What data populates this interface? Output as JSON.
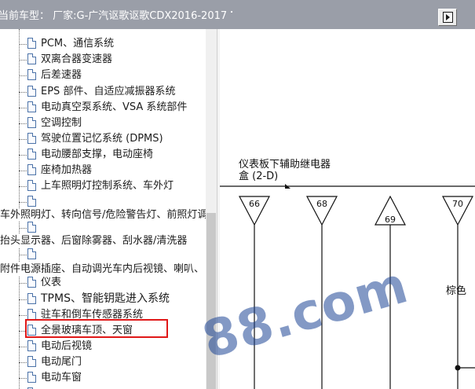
{
  "header": {
    "title": "当前车型： 厂家:G-广汽讴歌讴歌CDX2016-2017"
  },
  "tree": {
    "items": [
      {
        "label": "PCM、通信系统"
      },
      {
        "label": "双离合器变速器"
      },
      {
        "label": "后差速器"
      },
      {
        "label": "EPS 部件、自适应减振器系统"
      },
      {
        "label": "电动真空泵系统、VSA 系统部件"
      },
      {
        "label": "空调控制"
      },
      {
        "label": "驾驶位置记忆系统 (DPMS)"
      },
      {
        "label": "电动腰部支撑，电动座椅"
      },
      {
        "label": "座椅加热器"
      },
      {
        "label": "上车照明灯控制系统、车外灯"
      },
      {
        "label": ""
      },
      {
        "label": ""
      },
      {
        "label": ""
      },
      {
        "label": "仪表"
      },
      {
        "label": "TPMS、智能钥匙进入系统"
      },
      {
        "label": "驻车和倒车传感器系统"
      },
      {
        "label": "全景玻璃车顶、天窗"
      },
      {
        "label": "电动后视镜"
      },
      {
        "label": "电动尾门"
      },
      {
        "label": "电动车窗"
      },
      {
        "label": ""
      }
    ],
    "categories": [
      {
        "label": "车外照明灯、转向信号/危险警告灯、前照灯调"
      },
      {
        "label": "抬头显示器、后窗除雾器、刮水器/清洗器"
      },
      {
        "label": "附件电源插座、自动调光车内后视镜、喇叭、"
      }
    ]
  },
  "diagram": {
    "relay_title_line1": "仪表板下辅助继电器",
    "relay_title_line2": "盒 (2-D)",
    "connectors": [
      "66",
      "68",
      "69",
      "70"
    ],
    "wire_color_label": "棕色",
    "watermark": "88.com"
  }
}
